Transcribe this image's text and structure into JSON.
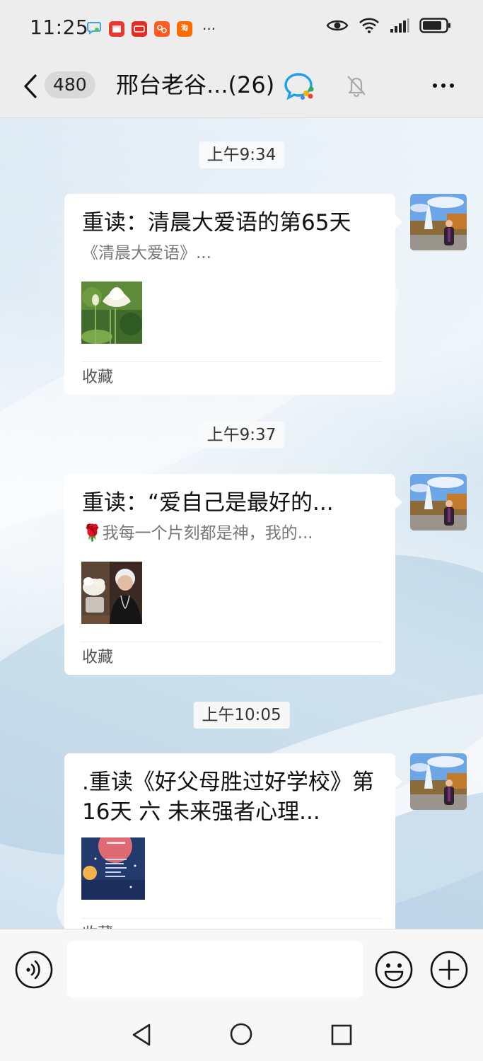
{
  "status_bar": {
    "time": "11:25",
    "apps": [
      {
        "icon": "chat-bubble-app-icon",
        "label": "",
        "color": "#ffffff"
      },
      {
        "icon": "red-app-icon",
        "label": "",
        "color": "#e8382f"
      },
      {
        "icon": "pinduoduo-icon",
        "label": "",
        "color": "#e02e24"
      },
      {
        "icon": "orange-app-icon",
        "label": "",
        "color": "#ff5a1f"
      },
      {
        "icon": "taobao-icon",
        "label": "淘",
        "color": "#ff6a00"
      }
    ],
    "more": "···",
    "icons": [
      "eye-icon",
      "wifi-icon",
      "signal-icon",
      "battery-icon"
    ]
  },
  "header": {
    "unread_count": "480",
    "title": "邢台老谷...(26)",
    "icons": [
      "back-arrow-icon",
      "group-chat-icon",
      "mute-bell-icon",
      "more-dots-icon"
    ]
  },
  "messages": [
    {
      "time": "上午9:34",
      "title": "重读：清晨大爱语的第65天",
      "desc": "《清晨大爱语》...",
      "thumb": "lotus-thumbnail",
      "source": "收藏"
    },
    {
      "time": "上午9:37",
      "title": "重读：“爱自己是最好的...",
      "desc": "🌹我每一个片刻都是神，我的...",
      "thumb": "elderly-woman-thumbnail",
      "source": "收藏"
    },
    {
      "time": "上午10:05",
      "title": ".重读《好父母胜过好学校》第16天  六  未来强者心理...",
      "desc": "",
      "thumb": "book-cover-thumbnail",
      "source": "收藏"
    }
  ],
  "input_bar": {
    "placeholder": "",
    "icons": [
      "voice-icon",
      "emoji-icon",
      "plus-icon"
    ]
  },
  "nav_bar": {
    "icons": [
      "nav-back-icon",
      "nav-home-icon",
      "nav-recent-icon"
    ]
  },
  "colors": {
    "background": "#ededed",
    "bubble": "#ffffff",
    "accent_blue": "#1aa1e8"
  }
}
